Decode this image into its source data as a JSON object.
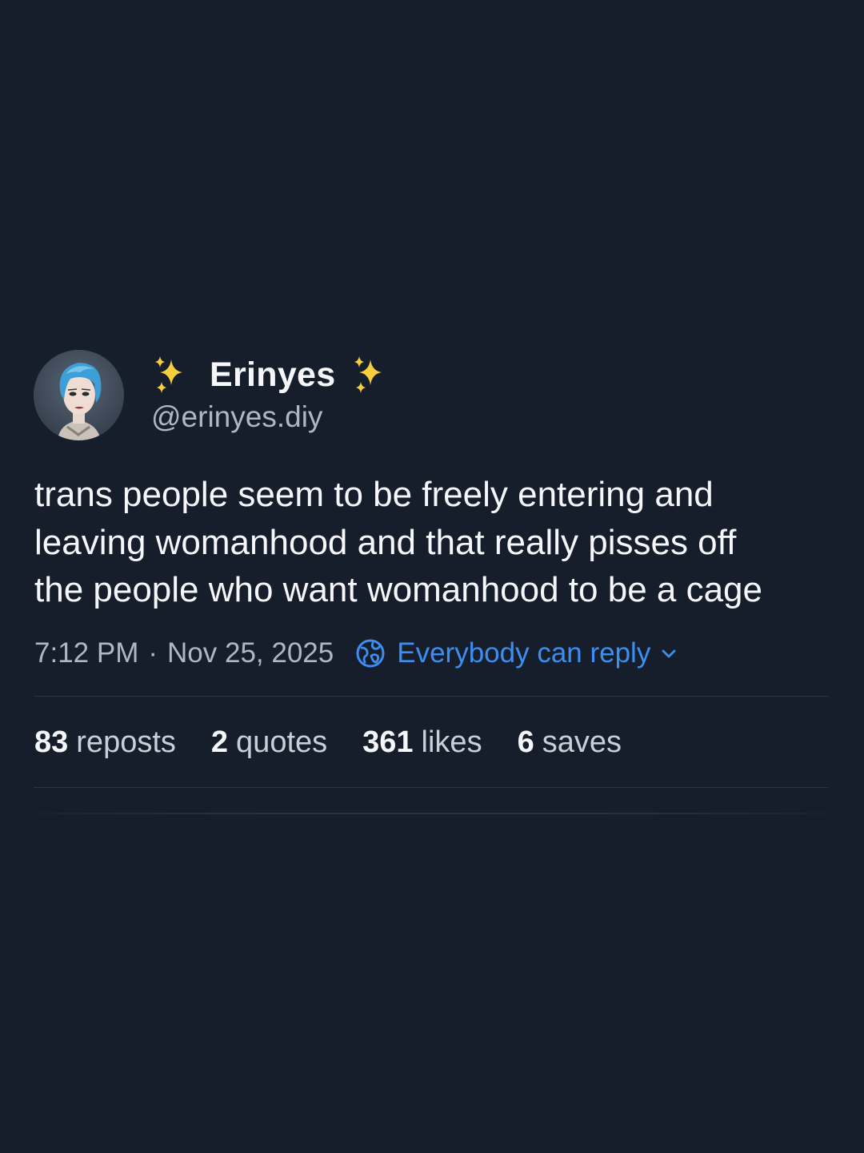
{
  "author": {
    "display_name": "Erinyes",
    "handle": "@erinyes.diy",
    "name_emoji_left": "sparkles-icon",
    "name_emoji_right": "sparkles-icon"
  },
  "post": {
    "text_lines": [
      "trans people seem to be freely entering and",
      "leaving womanhood and that really pisses off",
      "the people who want womanhood to be a cage"
    ],
    "time": "7:12 PM",
    "separator": "·",
    "date": "Nov 25, 2025",
    "reply_setting": "Everybody can reply"
  },
  "stats": [
    {
      "count": "83",
      "label": "reposts"
    },
    {
      "count": "2",
      "label": "quotes"
    },
    {
      "count": "361",
      "label": "likes"
    },
    {
      "count": "6",
      "label": "saves"
    }
  ],
  "colors": {
    "background": "#161e2b",
    "accent": "#3d8ef0",
    "sparkle": "#f7cf3c",
    "secondary_text": "#aeb7c2"
  }
}
